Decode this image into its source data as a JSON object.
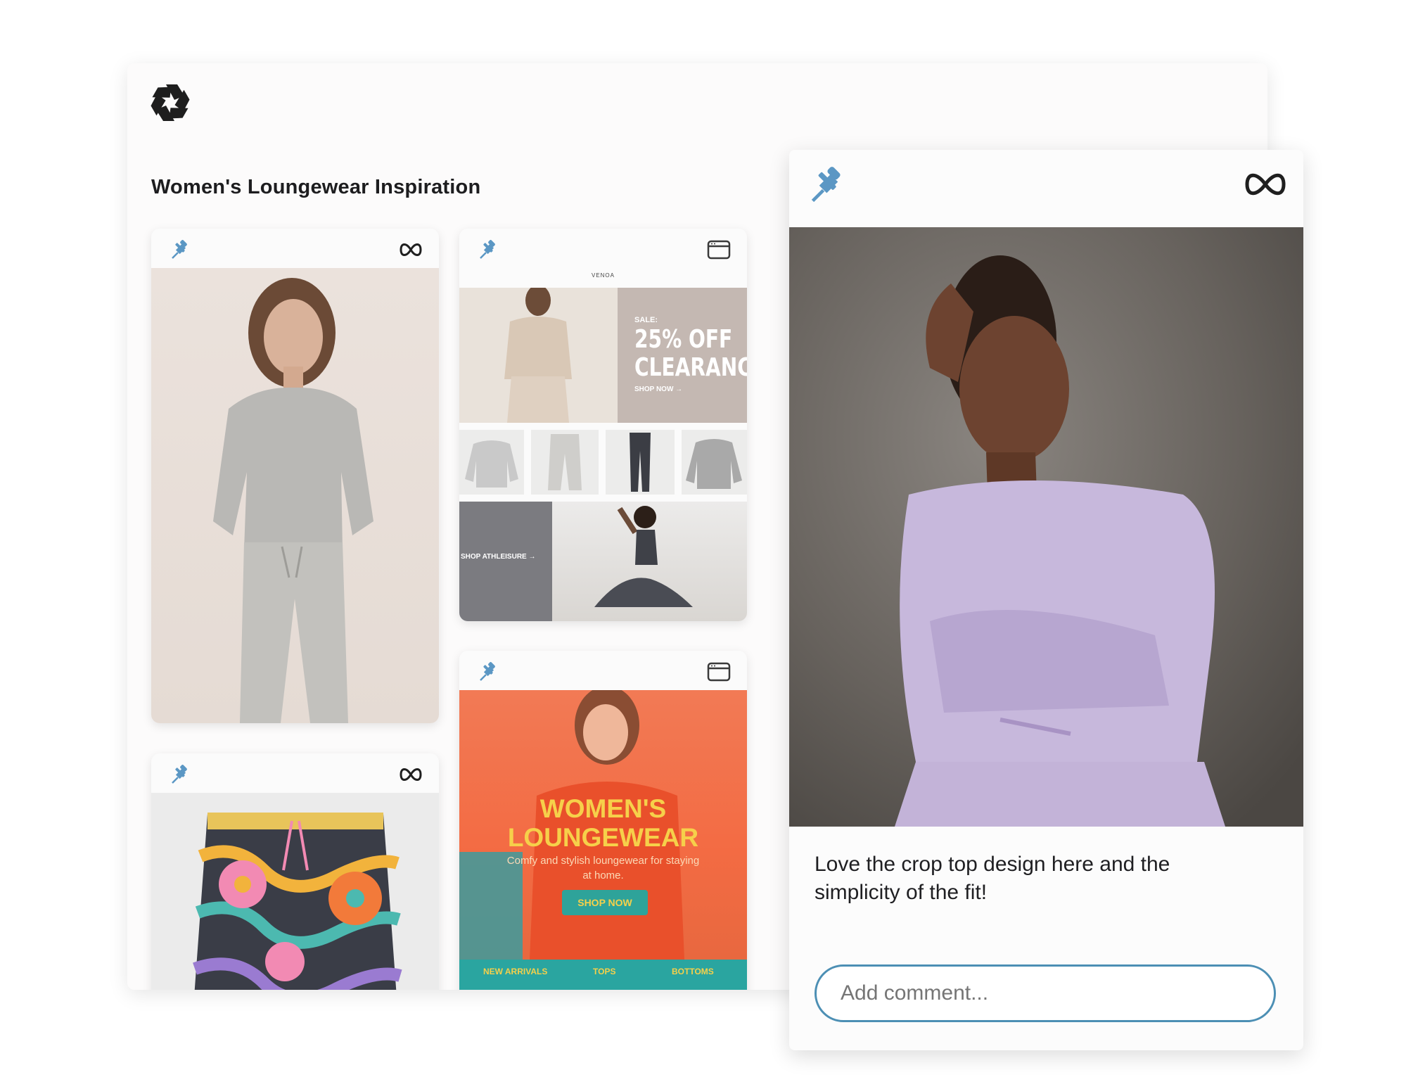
{
  "board": {
    "title": "Women's Loungewear Inspiration",
    "logo_icon": "aperture-icon"
  },
  "cards": {
    "sweatsuit": {
      "pin_icon": "pushpin-icon",
      "source_icon": "meta-icon"
    },
    "sale_email": {
      "pin_icon": "pushpin-icon",
      "source_icon": "browser-window-icon",
      "brand": "VENOA",
      "sale_label": "SALE:",
      "sale_line1": "25% OFF",
      "sale_line2": "CLEARANCE",
      "sale_cta": "SHOP NOW →",
      "shop_label": "SHOP ATHLEISURE →"
    },
    "floral_pants": {
      "pin_icon": "pushpin-icon",
      "source_icon": "meta-icon"
    },
    "loungewear_email": {
      "pin_icon": "pushpin-icon",
      "source_icon": "browser-window-icon",
      "headline_1": "WOMEN'S",
      "headline_2": "LOUNGEWEAR",
      "subtext": "Comfy and stylish loungewear for staying at home.",
      "button": "SHOP NOW",
      "nav": [
        "NEW ARRIVALS",
        "TOPS",
        "BOTTOMS"
      ]
    }
  },
  "detail": {
    "pin_icon": "pushpin-icon",
    "source_icon": "meta-icon",
    "caption": "Love the crop top design here and the simplicity of the fit!",
    "comment_placeholder": "Add comment..."
  },
  "colors": {
    "pin_blue": "#5b97c4",
    "input_border": "#4c8fb4",
    "promo_orange": "#f36b43",
    "promo_yellow": "#f6d04a",
    "promo_teal": "#2aa5a0"
  }
}
